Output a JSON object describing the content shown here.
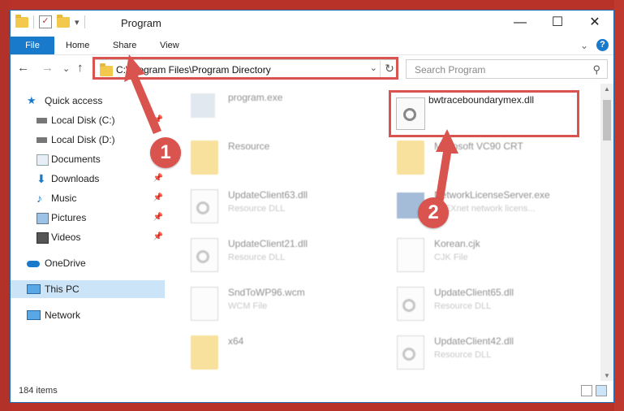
{
  "window": {
    "title": "Program",
    "controls": {
      "minimize": "—",
      "maximize": "☐",
      "close": "✕"
    }
  },
  "ribbon": {
    "tabs": [
      "File",
      "Home",
      "Share",
      "View"
    ],
    "expand": "⌄",
    "help": "?"
  },
  "navigation": {
    "back": "←",
    "forward": "→",
    "recent": "⌄",
    "up": "↑",
    "address": "C:\\Program Files\\Program Directory",
    "address_dropdown": "⌄",
    "refresh": "↻",
    "search_placeholder": "Search Program",
    "search_icon": "⚲"
  },
  "sidebar": {
    "items": [
      {
        "label": "Quick access",
        "icon": "star-icon",
        "pinned": false
      },
      {
        "label": "Local Disk (C:)",
        "icon": "drive-icon",
        "pinned": true
      },
      {
        "label": "Local Disk (D:)",
        "icon": "drive-icon",
        "pinned": false
      },
      {
        "label": "Documents",
        "icon": "documents-icon",
        "pinned": true
      },
      {
        "label": "Downloads",
        "icon": "download-icon",
        "pinned": true
      },
      {
        "label": "Music",
        "icon": "music-icon",
        "pinned": true
      },
      {
        "label": "Pictures",
        "icon": "pictures-icon",
        "pinned": true
      },
      {
        "label": "Videos",
        "icon": "videos-icon",
        "pinned": true
      },
      {
        "label": "OneDrive",
        "icon": "cloud-icon",
        "pinned": false
      },
      {
        "label": "This PC",
        "icon": "computer-icon",
        "pinned": false,
        "selected": true
      },
      {
        "label": "Network",
        "icon": "network-icon",
        "pinned": false
      }
    ],
    "pin_glyph": "📌"
  },
  "files": [
    {
      "name": "program.exe",
      "type": ""
    },
    {
      "name": "bwtraceboundarymex.dll",
      "type": ""
    },
    {
      "name": "Resource",
      "type": ""
    },
    {
      "name": "Microsoft VC90 CRT",
      "type": ""
    },
    {
      "name": "UpdateClient63.dll",
      "type": "Resource DLL"
    },
    {
      "name": "NetworkLicenseServer.exe",
      "type": "FLEXnet network licens..."
    },
    {
      "name": "UpdateClient21.dll",
      "type": "Resource DLL"
    },
    {
      "name": "Korean.cjk",
      "type": "CJK File"
    },
    {
      "name": "SndToWP96.wcm",
      "type": "WCM File"
    },
    {
      "name": "UpdateClient65.dll",
      "type": "Resource DLL"
    },
    {
      "name": "x64",
      "type": ""
    },
    {
      "name": "UpdateClient42.dll",
      "type": "Resource DLL"
    }
  ],
  "annotations": {
    "step1": "1",
    "step2": "2"
  },
  "status": {
    "item_count": "184 items"
  },
  "colors": {
    "accent": "#1979ca",
    "highlight": "#d9534f",
    "background": "#b8322a"
  }
}
